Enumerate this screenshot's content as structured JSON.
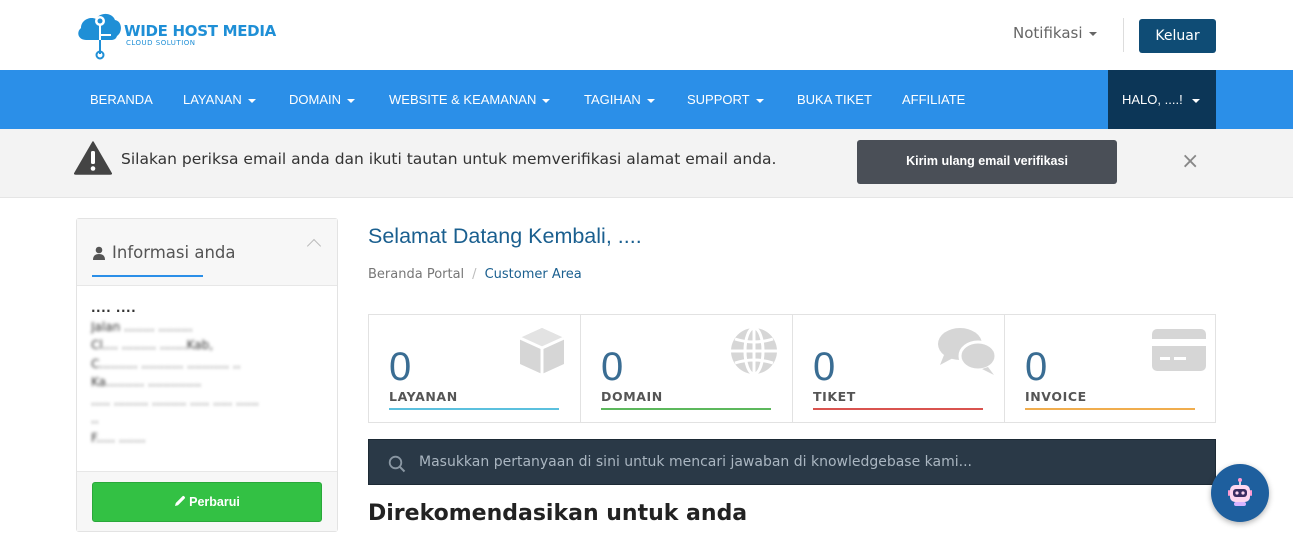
{
  "brand": {
    "name": "WIDE HOST MEDIA",
    "tagline": "CLOUD SOLUTION",
    "color": "#1f8fd6"
  },
  "header": {
    "notifications_label": "Notifikasi",
    "logout_label": "Keluar"
  },
  "nav": {
    "items": [
      {
        "label": "BERANDA",
        "dropdown": false
      },
      {
        "label": "LAYANAN",
        "dropdown": true
      },
      {
        "label": "DOMAIN",
        "dropdown": true
      },
      {
        "label": "WEBSITE & KEAMANAN",
        "dropdown": true
      },
      {
        "label": "TAGIHAN",
        "dropdown": true
      },
      {
        "label": "SUPPORT",
        "dropdown": true
      },
      {
        "label": "BUKA TIKET",
        "dropdown": false
      },
      {
        "label": "AFFILIATE",
        "dropdown": false
      }
    ],
    "user_label": "HALO, ....!",
    "colors": {
      "bar": "#2b8fe8",
      "user": "#0c3657"
    }
  },
  "alert": {
    "message": "Silakan periksa email anda dan ikuti tautan untuk memverifikasi alamat email anda.",
    "button_label": "Kirim ulang email verifikasi",
    "close_glyph": "×",
    "icon": "warning-icon"
  },
  "sidebar": {
    "title": "Informasi anda",
    "name": ".... ....",
    "address_lines": [
      "Jalan ........ .........",
      "Cl.... ......... .......Kab,",
      "C.......... ........... ........... ..",
      "Ka.......... ..............",
      "..... ......... ......... ..... ..... ......",
      "..",
      "F..... ......."
    ],
    "update_label": "Perbarui"
  },
  "main": {
    "welcome": "Selamat Datang Kembali, ....",
    "breadcrumb": {
      "home": "Beranda Portal",
      "separator": "/",
      "current": "Customer Area"
    },
    "tiles": [
      {
        "count": "0",
        "label": "LAYANAN",
        "icon": "box-icon",
        "color": "#5bc0de"
      },
      {
        "count": "0",
        "label": "DOMAIN",
        "icon": "globe-icon",
        "color": "#5cb85c"
      },
      {
        "count": "0",
        "label": "TIKET",
        "icon": "comments-icon",
        "color": "#d9534f"
      },
      {
        "count": "0",
        "label": "INVOICE",
        "icon": "credit-card-icon",
        "color": "#f0ad4e"
      }
    ],
    "search_placeholder": "Masukkan pertanyaan di sini untuk mencari jawaban di knowledgebase kami...",
    "recommend_title": "Direkomendasikan untuk anda"
  },
  "chat": {
    "icon": "chat-bot-icon"
  }
}
